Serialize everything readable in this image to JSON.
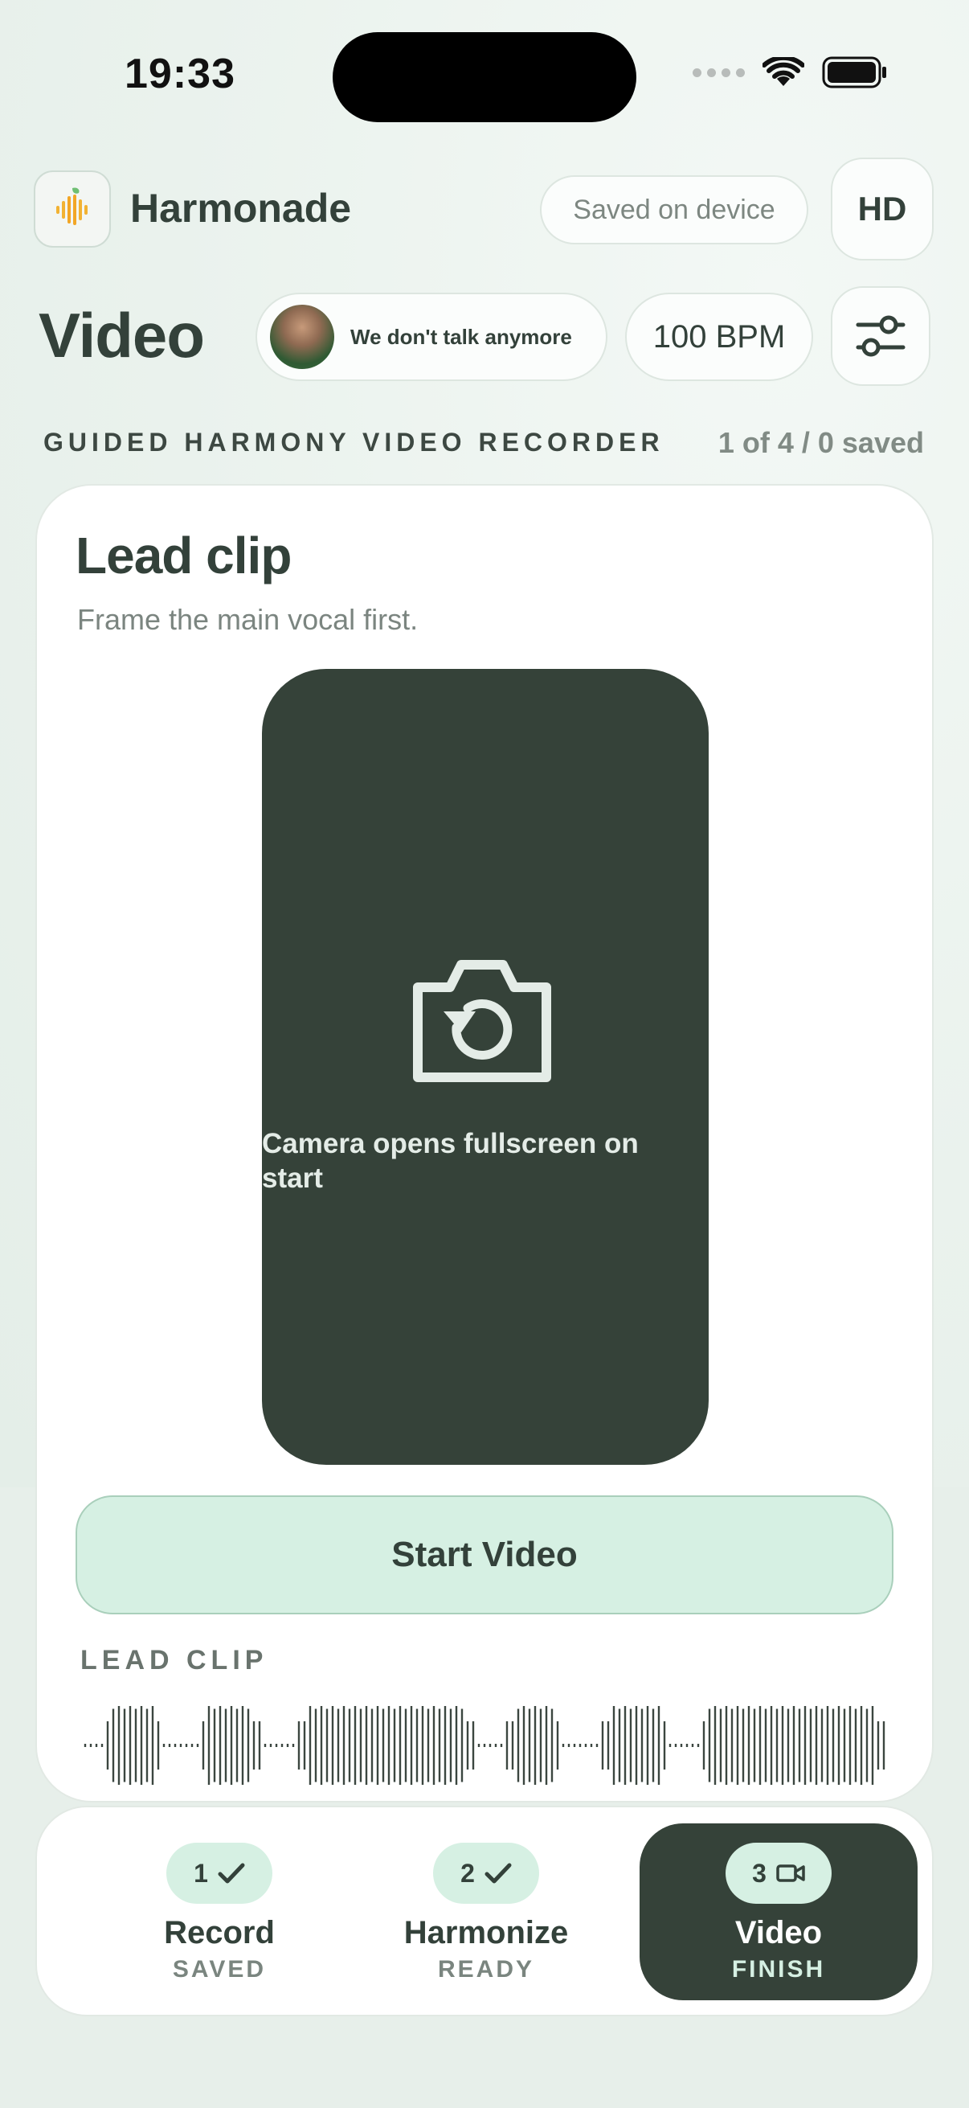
{
  "status_bar": {
    "time": "19:33"
  },
  "header": {
    "app_name": "Harmonade",
    "saved_label": "Saved on device",
    "quality_label": "HD"
  },
  "title_row": {
    "page_title": "Video",
    "song_title": "We don't talk anymore",
    "tempo": "100 BPM"
  },
  "section": {
    "label": "GUIDED HARMONY VIDEO RECORDER",
    "progress": "1 of 4 / 0 saved"
  },
  "card": {
    "title": "Lead clip",
    "subtitle": "Frame the main vocal first.",
    "camera_hint": "Camera opens fullscreen on start",
    "start_button": "Start Video",
    "clip_label": "LEAD CLIP"
  },
  "tabs": [
    {
      "number": "1",
      "name": "Record",
      "status": "SAVED",
      "icon": "check-icon",
      "active": false
    },
    {
      "number": "2",
      "name": "Harmonize",
      "status": "READY",
      "icon": "check-icon",
      "active": false
    },
    {
      "number": "3",
      "name": "Video",
      "status": "FINISH",
      "icon": "video-camera-icon",
      "active": true
    }
  ],
  "colors": {
    "background": "#e6efea",
    "dark": "#354239",
    "accent_mint": "#d6f0e3",
    "accent_border": "#a9cfbb",
    "text": "#33413a",
    "muted_text": "#7b8580"
  }
}
